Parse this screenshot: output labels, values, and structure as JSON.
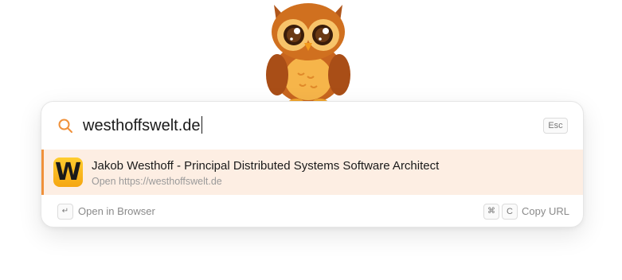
{
  "search": {
    "query": "westhoffswelt.de",
    "escape_key": "Esc"
  },
  "result": {
    "logo_letter": "W",
    "title": "Jakob Westhoff - Principal Distributed Systems Software Architect",
    "subtitle": "Open https://westhoffswelt.de"
  },
  "footer": {
    "primary_key": "↵",
    "primary_label": "Open in Browser",
    "secondary_modifier_key": "⌘",
    "secondary_key": "C",
    "secondary_label": "Copy URL"
  },
  "colors": {
    "accent": "#f0913a",
    "selected_row_bg": "#fdeee3",
    "logo_yellow": "#ffcd2e"
  },
  "icons": {
    "mascot": "owl-mascot-icon",
    "search": "search-icon"
  }
}
